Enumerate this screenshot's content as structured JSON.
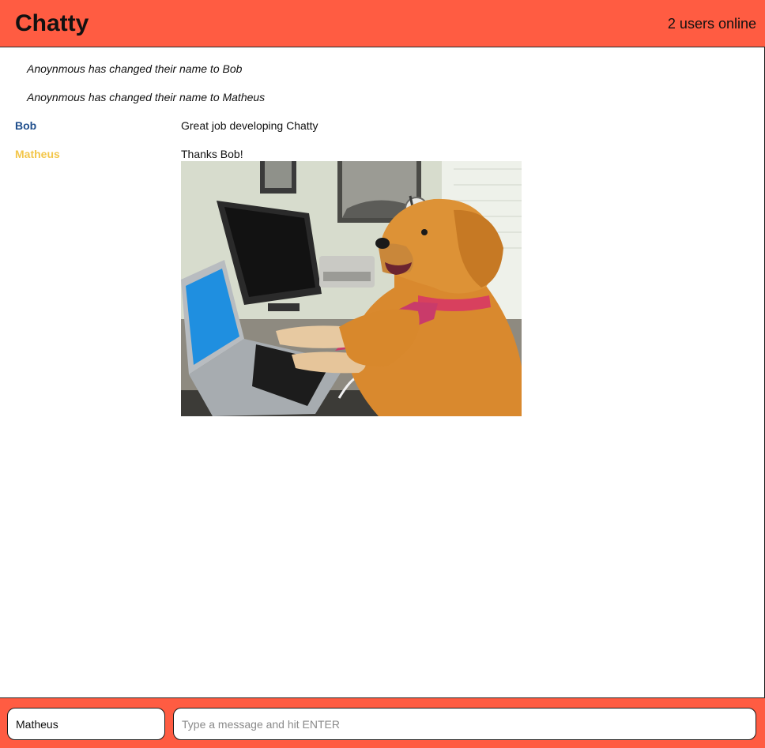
{
  "header": {
    "brand": "Chatty",
    "users_online": "2 users online"
  },
  "messages": {
    "notifications": [
      "Anoynmous has changed their name to Bob",
      "Anoynmous has changed their name to Matheus"
    ],
    "chat": [
      {
        "username": "Bob",
        "color": "#1f4e8c",
        "content": "Great job developing Chatty"
      },
      {
        "username": "Matheus",
        "color": "#f3c64a",
        "content": "Thanks Bob!"
      }
    ],
    "image_alt": "golden retriever wearing a pink tie typing on a laptop"
  },
  "composer": {
    "username_value": "Matheus",
    "message_placeholder": "Type a message and hit ENTER"
  },
  "colors": {
    "accent": "#ff5c42"
  }
}
